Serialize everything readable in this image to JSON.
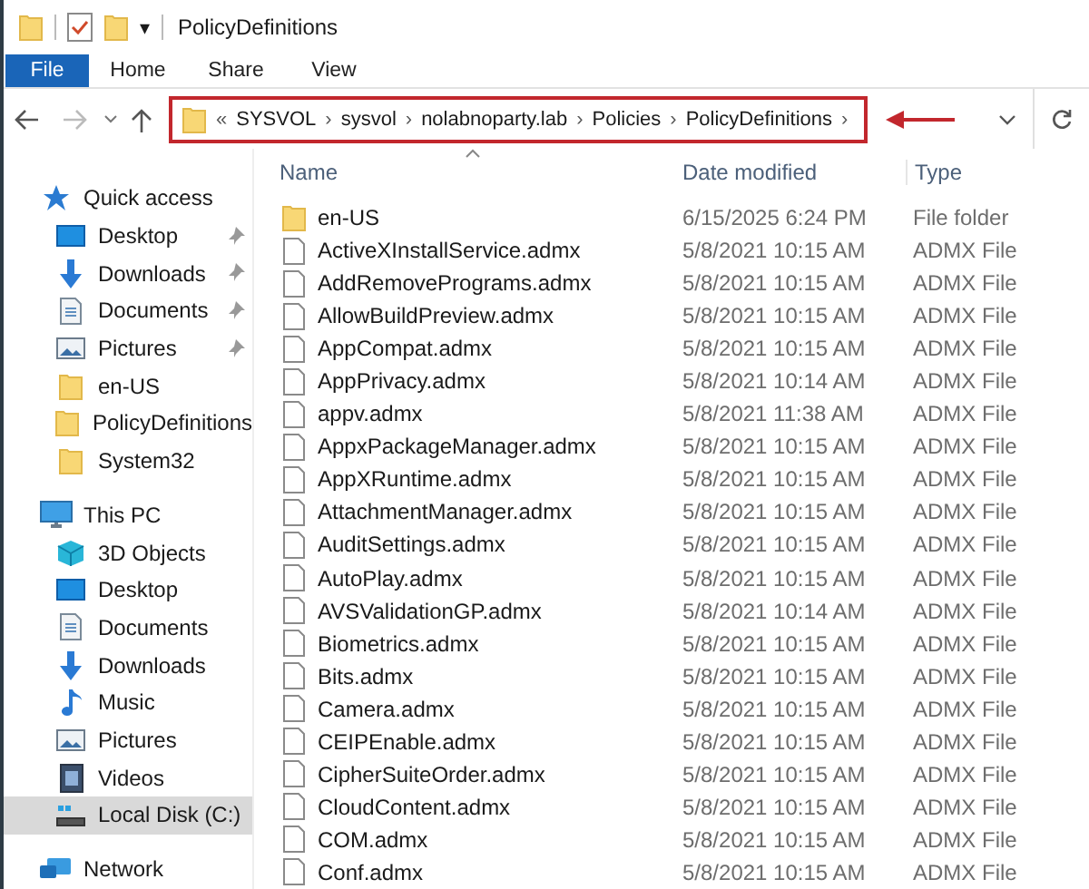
{
  "window": {
    "title": "PolicyDefinitions",
    "customize_glyph": "▾"
  },
  "ribbon": {
    "tabs": [
      {
        "label": "File",
        "kind": "file"
      },
      {
        "label": "Home",
        "kind": "tab"
      },
      {
        "label": "Share",
        "kind": "tab"
      },
      {
        "label": "View",
        "kind": "tab"
      }
    ]
  },
  "address_bar": {
    "overflow": "«",
    "separator": "›",
    "highlighted": true,
    "crumbs": [
      "SYSVOL",
      "sysvol",
      "nolabnoparty.lab",
      "Policies",
      "PolicyDefinitions"
    ]
  },
  "navigation_pane": [
    {
      "label": "Quick access",
      "kind": "quick",
      "selected": false,
      "children": [
        {
          "label": "Desktop",
          "kind": "desktop",
          "pinned": true,
          "selected": false
        },
        {
          "label": "Downloads",
          "kind": "downloads",
          "pinned": true,
          "selected": false
        },
        {
          "label": "Documents",
          "kind": "documents",
          "pinned": true,
          "selected": false
        },
        {
          "label": "Pictures",
          "kind": "pictures",
          "pinned": true,
          "selected": false
        },
        {
          "label": "en-US",
          "kind": "folder",
          "pinned": false,
          "selected": false
        },
        {
          "label": "PolicyDefinitions",
          "kind": "folder",
          "pinned": false,
          "selected": false
        },
        {
          "label": "System32",
          "kind": "folder",
          "pinned": false,
          "selected": false
        }
      ]
    },
    {
      "label": "This PC",
      "kind": "pc",
      "selected": false,
      "children": [
        {
          "label": "3D Objects",
          "kind": "objects",
          "selected": false
        },
        {
          "label": "Desktop",
          "kind": "desktop",
          "selected": false
        },
        {
          "label": "Documents",
          "kind": "documents",
          "selected": false
        },
        {
          "label": "Downloads",
          "kind": "downloads",
          "selected": false
        },
        {
          "label": "Music",
          "kind": "music",
          "selected": false
        },
        {
          "label": "Pictures",
          "kind": "pictures",
          "selected": false
        },
        {
          "label": "Videos",
          "kind": "videos",
          "selected": false
        },
        {
          "label": "Local Disk (C:)",
          "kind": "disk",
          "selected": true
        }
      ]
    },
    {
      "label": "Network",
      "kind": "network",
      "selected": false
    }
  ],
  "file_list": {
    "columns": [
      {
        "label": "Name",
        "sorted": true
      },
      {
        "label": "Date modified",
        "sorted": false
      },
      {
        "label": "Type",
        "sorted": false
      }
    ],
    "rows": [
      {
        "kind": "folder",
        "name": "en-US",
        "date": "6/15/2025 6:24 PM",
        "type": "File folder"
      },
      {
        "kind": "file",
        "name": "ActiveXInstallService.admx",
        "date": "5/8/2021 10:15 AM",
        "type": "ADMX File"
      },
      {
        "kind": "file",
        "name": "AddRemovePrograms.admx",
        "date": "5/8/2021 10:15 AM",
        "type": "ADMX File"
      },
      {
        "kind": "file",
        "name": "AllowBuildPreview.admx",
        "date": "5/8/2021 10:15 AM",
        "type": "ADMX File"
      },
      {
        "kind": "file",
        "name": "AppCompat.admx",
        "date": "5/8/2021 10:15 AM",
        "type": "ADMX File"
      },
      {
        "kind": "file",
        "name": "AppPrivacy.admx",
        "date": "5/8/2021 10:14 AM",
        "type": "ADMX File"
      },
      {
        "kind": "file",
        "name": "appv.admx",
        "date": "5/8/2021 11:38 AM",
        "type": "ADMX File"
      },
      {
        "kind": "file",
        "name": "AppxPackageManager.admx",
        "date": "5/8/2021 10:15 AM",
        "type": "ADMX File"
      },
      {
        "kind": "file",
        "name": "AppXRuntime.admx",
        "date": "5/8/2021 10:15 AM",
        "type": "ADMX File"
      },
      {
        "kind": "file",
        "name": "AttachmentManager.admx",
        "date": "5/8/2021 10:15 AM",
        "type": "ADMX File"
      },
      {
        "kind": "file",
        "name": "AuditSettings.admx",
        "date": "5/8/2021 10:15 AM",
        "type": "ADMX File"
      },
      {
        "kind": "file",
        "name": "AutoPlay.admx",
        "date": "5/8/2021 10:15 AM",
        "type": "ADMX File"
      },
      {
        "kind": "file",
        "name": "AVSValidationGP.admx",
        "date": "5/8/2021 10:14 AM",
        "type": "ADMX File"
      },
      {
        "kind": "file",
        "name": "Biometrics.admx",
        "date": "5/8/2021 10:15 AM",
        "type": "ADMX File"
      },
      {
        "kind": "file",
        "name": "Bits.admx",
        "date": "5/8/2021 10:15 AM",
        "type": "ADMX File"
      },
      {
        "kind": "file",
        "name": "Camera.admx",
        "date": "5/8/2021 10:15 AM",
        "type": "ADMX File"
      },
      {
        "kind": "file",
        "name": "CEIPEnable.admx",
        "date": "5/8/2021 10:15 AM",
        "type": "ADMX File"
      },
      {
        "kind": "file",
        "name": "CipherSuiteOrder.admx",
        "date": "5/8/2021 10:15 AM",
        "type": "ADMX File"
      },
      {
        "kind": "file",
        "name": "CloudContent.admx",
        "date": "5/8/2021 10:15 AM",
        "type": "ADMX File"
      },
      {
        "kind": "file",
        "name": "COM.admx",
        "date": "5/8/2021 10:15 AM",
        "type": "ADMX File"
      },
      {
        "kind": "file",
        "name": "Conf.admx",
        "date": "5/8/2021 10:15 AM",
        "type": "ADMX File"
      }
    ]
  }
}
